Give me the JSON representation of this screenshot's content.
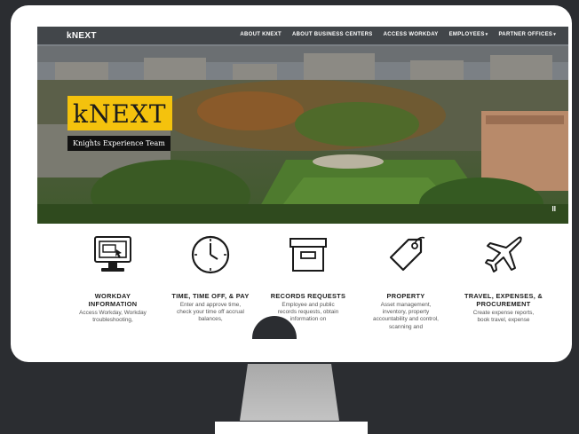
{
  "header": {
    "brand": "kNEXT",
    "nav": [
      {
        "label": "ABOUT KNEXT",
        "dropdown": false
      },
      {
        "label": "ABOUT BUSINESS CENTERS",
        "dropdown": false
      },
      {
        "label": "ACCESS WORKDAY",
        "dropdown": false
      },
      {
        "label": "EMPLOYEES",
        "dropdown": true
      },
      {
        "label": "PARTNER OFFICES",
        "dropdown": true
      }
    ]
  },
  "hero": {
    "title": "kNEXT",
    "subtitle": "Knights Experience Team",
    "pause_glyph": "II"
  },
  "tiles": [
    {
      "icon": "computer-monitor-icon",
      "title": "WORKDAY INFORMATION",
      "desc": "Access Workday, Workday troubleshooting,"
    },
    {
      "icon": "clock-icon",
      "title": "TIME, TIME OFF, & PAY",
      "desc": "Enter and approve time, check your time off accrual balances,"
    },
    {
      "icon": "archive-box-icon",
      "title": "RECORDS REQUESTS",
      "desc": "Employee and public records requests, obtain information on"
    },
    {
      "icon": "price-tag-icon",
      "title": "PROPERTY",
      "desc": "Asset management, inventory, property accountability and control, scanning and"
    },
    {
      "icon": "airplane-icon",
      "title": "TRAVEL, EXPENSES, & PROCUREMENT",
      "desc": "Create expense reports, book travel, expense"
    }
  ],
  "colors": {
    "accent": "#f4c20d",
    "background": "#2b2d31",
    "text_dark": "#1e1e1e"
  }
}
